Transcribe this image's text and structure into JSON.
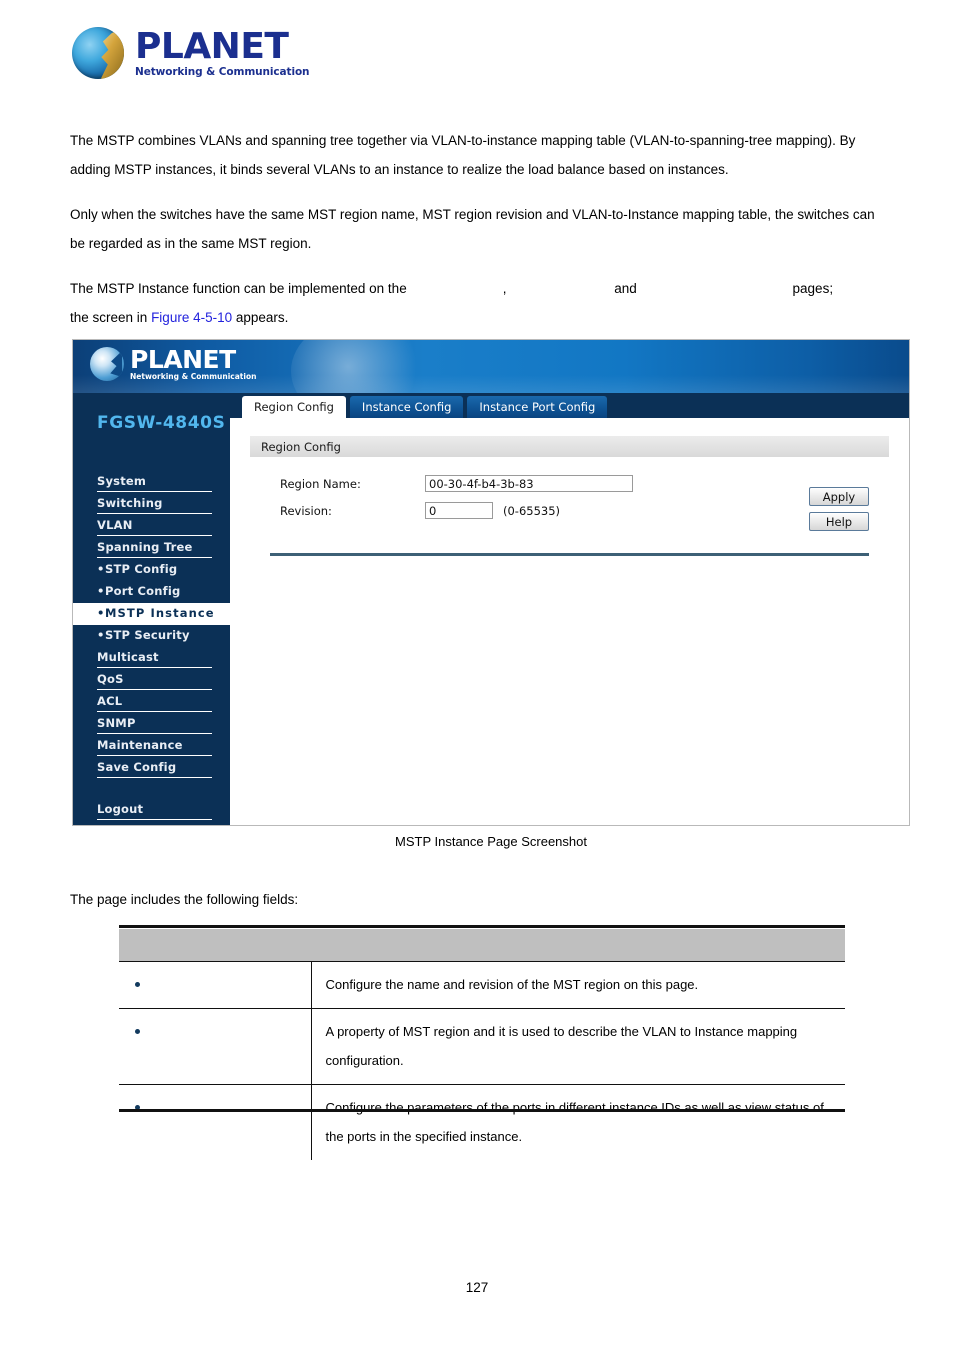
{
  "brand": {
    "name": "PLANET",
    "tagline": "Networking & Communication"
  },
  "document": {
    "paragraphs": [
      "The MSTP combines VLANs and spanning tree together via VLAN-to-instance mapping table (VLAN-to-spanning-tree mapping). By adding MSTP instances, it binds several VLANs to an instance to realize the load balance based on instances.",
      "Only when the switches have the same MST region name, MST region revision and VLAN-to-Instance mapping table, the switches can be regarded as in the same MST region."
    ],
    "implemented_sentence": {
      "prefix": "The MSTP Instance function can be implemented on the",
      "ref1": "",
      "comma": ",",
      "ref2": "",
      "and": "and",
      "ref3": "",
      "suffix": "pages;"
    },
    "screen_sentence": {
      "prefix": "the screen in",
      "figure_link": "Figure 4-5-10",
      "suffix": "appears."
    },
    "caption": {
      "figure_label": "",
      "text": "MSTP Instance Page Screenshot"
    },
    "lead_in": "The page includes the following fields:",
    "page_number": "127"
  },
  "screenshot": {
    "model": "FGSW-4840S",
    "sidebar": [
      {
        "label": "System",
        "type": "top",
        "active": false
      },
      {
        "label": "Switching",
        "type": "top",
        "active": false
      },
      {
        "label": "VLAN",
        "type": "top",
        "active": false
      },
      {
        "label": "Spanning Tree",
        "type": "top",
        "active": false
      },
      {
        "label": "STP Config",
        "type": "sub",
        "active": false
      },
      {
        "label": "Port Config",
        "type": "sub",
        "active": false
      },
      {
        "label": "MSTP Instance",
        "type": "sub",
        "active": true
      },
      {
        "label": "STP Security",
        "type": "sub",
        "active": false
      },
      {
        "label": "Multicast",
        "type": "top",
        "active": false
      },
      {
        "label": "QoS",
        "type": "top",
        "active": false
      },
      {
        "label": "ACL",
        "type": "top",
        "active": false
      },
      {
        "label": "SNMP",
        "type": "top",
        "active": false
      },
      {
        "label": "Maintenance",
        "type": "top",
        "active": false
      },
      {
        "label": "Save Config",
        "type": "top",
        "active": false
      }
    ],
    "sidebar_logout": "Logout",
    "tabs": [
      {
        "label": "Region Config",
        "active": true
      },
      {
        "label": "Instance Config",
        "active": false
      },
      {
        "label": "Instance Port Config",
        "active": false
      }
    ],
    "panel": {
      "title": "Region Config",
      "region_name_label": "Region Name:",
      "region_name_value": "00-30-4f-b4-3b-83",
      "revision_label": "Revision:",
      "revision_value": "0",
      "revision_range": "(0-65535)",
      "apply_label": "Apply",
      "help_label": "Help"
    }
  },
  "fields_table": {
    "headers": {
      "col1": "",
      "col2": ""
    },
    "rows": [
      {
        "field": "",
        "description": "Configure the name and revision of the MST region on this page."
      },
      {
        "field": "",
        "description": "A property of MST region and it is used to describe the VLAN to Instance mapping configuration."
      },
      {
        "field": "",
        "description": "Configure the parameters of the ports in different instance IDs as well as view status of the ports in the specified instance."
      }
    ]
  },
  "colors": {
    "brand_blue": "#1b2f8f",
    "sidebar_navy": "#0b3056",
    "model_cyan": "#52b7ee",
    "link_blue": "#2222dd",
    "rule_slate": "#3d6076",
    "table_header_gray": "#bfbfbf"
  }
}
